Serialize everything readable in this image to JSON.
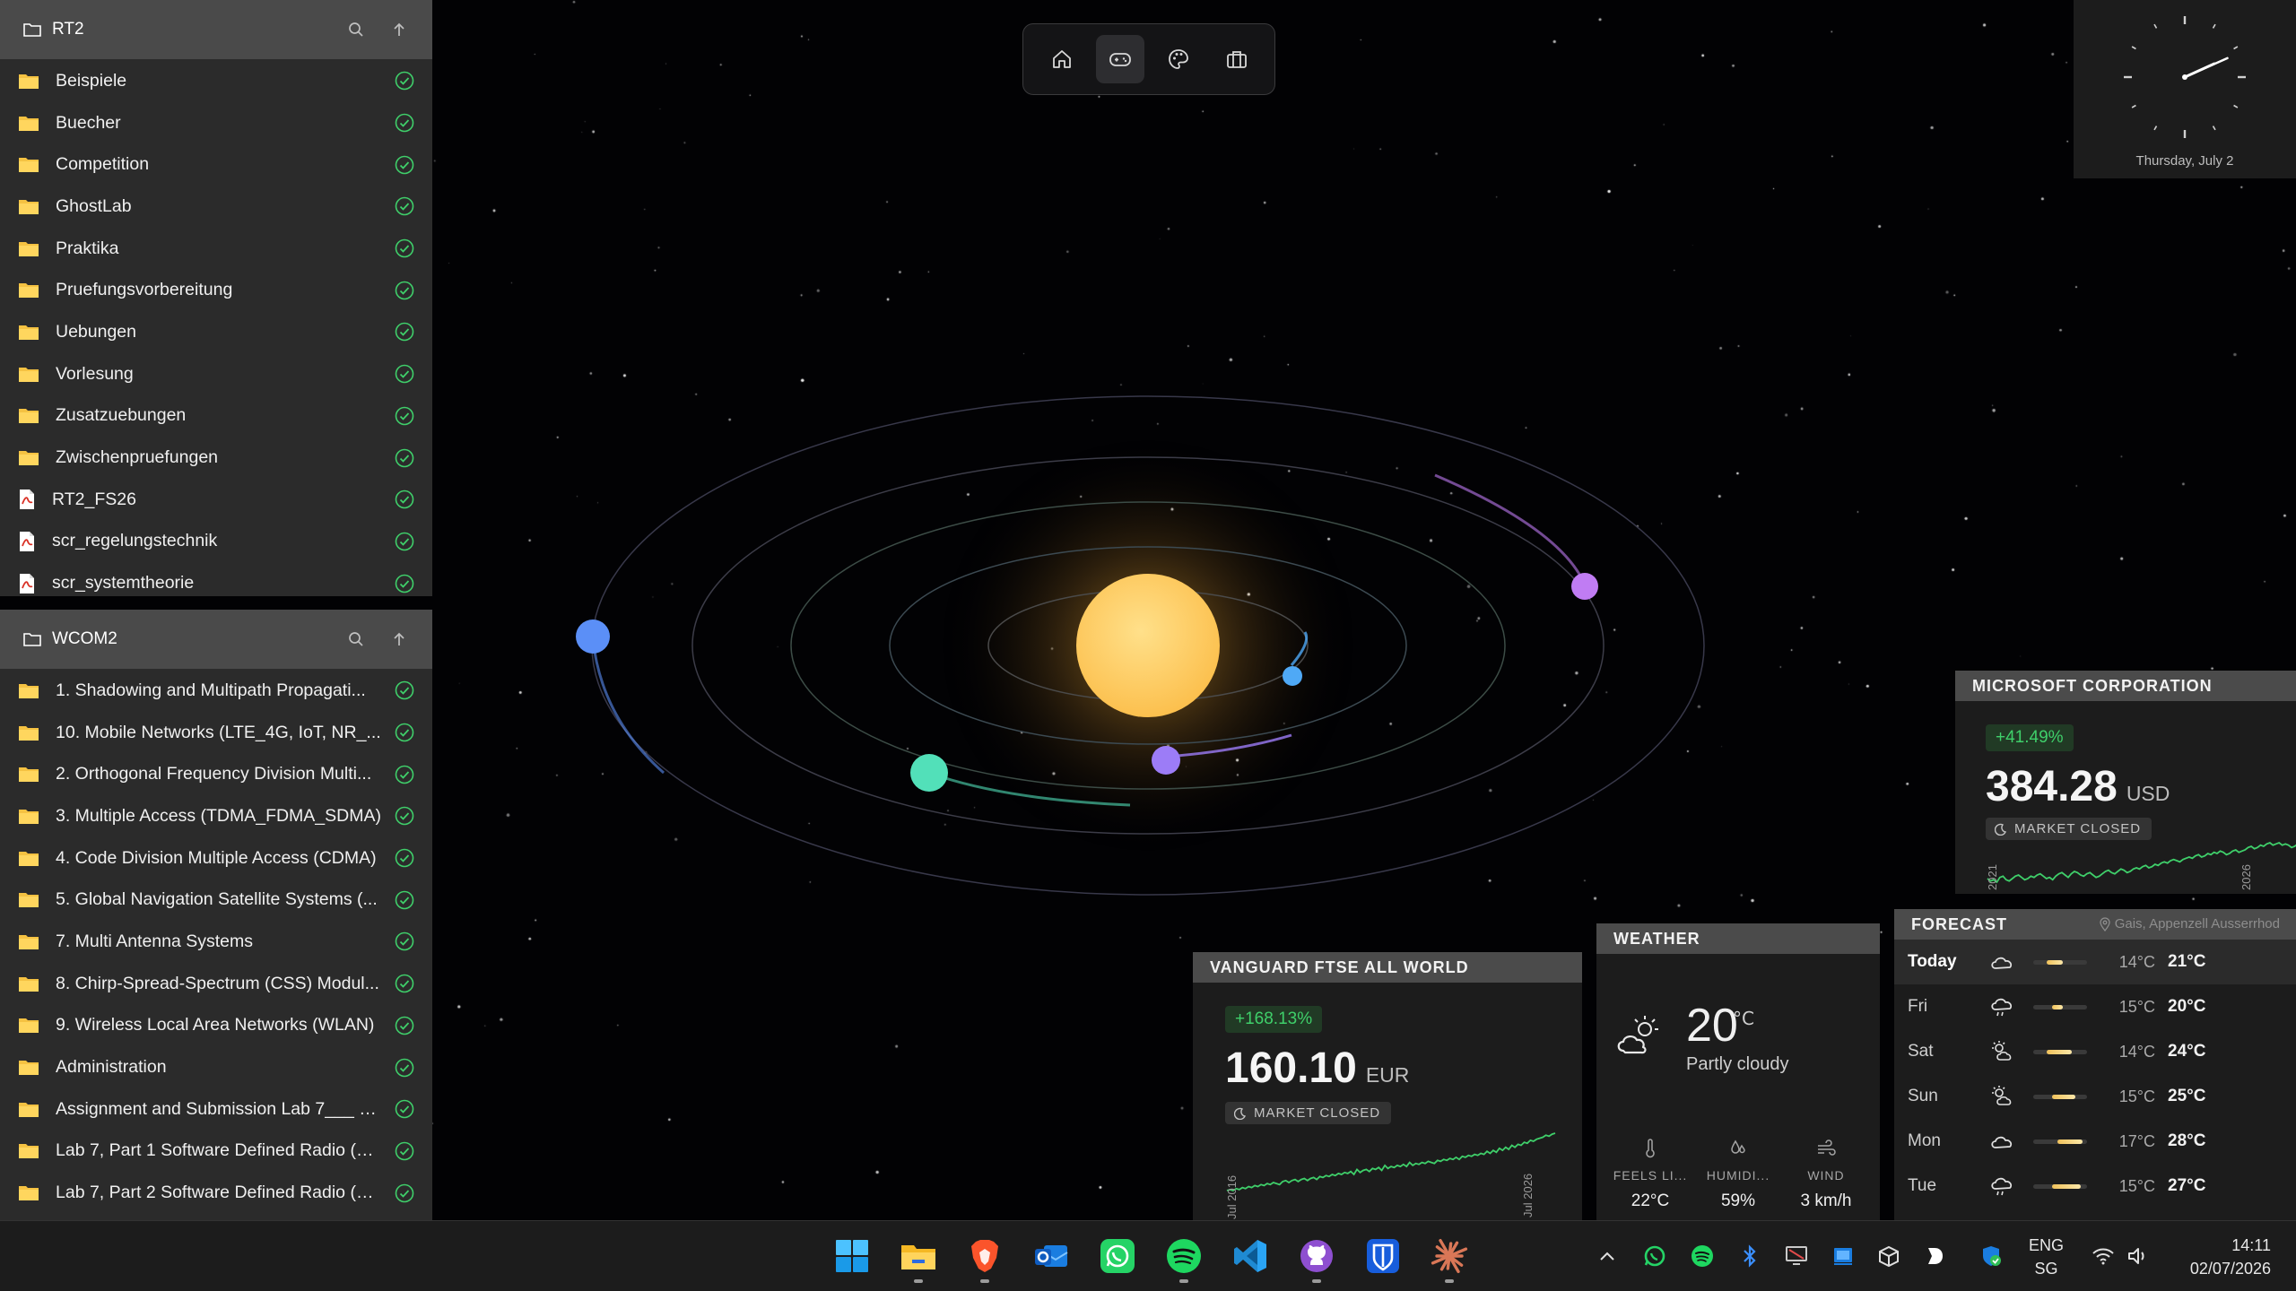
{
  "panels": [
    {
      "title": "RT2",
      "items": [
        {
          "label": "Beispiele",
          "type": "folder"
        },
        {
          "label": "Buecher",
          "type": "folder"
        },
        {
          "label": "Competition",
          "type": "folder"
        },
        {
          "label": "GhostLab",
          "type": "folder"
        },
        {
          "label": "Praktika",
          "type": "folder"
        },
        {
          "label": "Pruefungsvorbereitung",
          "type": "folder"
        },
        {
          "label": "Uebungen",
          "type": "folder"
        },
        {
          "label": "Vorlesung",
          "type": "folder"
        },
        {
          "label": "Zusatzuebungen",
          "type": "folder"
        },
        {
          "label": "Zwischenpruefungen",
          "type": "folder"
        },
        {
          "label": "RT2_FS26",
          "type": "pdf"
        },
        {
          "label": "scr_regelungstechnik",
          "type": "pdf"
        },
        {
          "label": "scr_systemtheorie",
          "type": "pdf"
        }
      ]
    },
    {
      "title": "WCOM2",
      "items": [
        {
          "label": "1. Shadowing and Multipath Propagati...",
          "type": "folder"
        },
        {
          "label": "10. Mobile Networks (LTE_4G, IoT, NR_...",
          "type": "folder"
        },
        {
          "label": "2. Orthogonal Frequency Division Multi...",
          "type": "folder"
        },
        {
          "label": "3. Multiple Access (TDMA_FDMA_SDMA)",
          "type": "folder"
        },
        {
          "label": "4. Code Division Multiple Access (CDMA)",
          "type": "folder"
        },
        {
          "label": "5. Global Navigation Satellite Systems (...",
          "type": "folder"
        },
        {
          "label": "7. Multi Antenna Systems",
          "type": "folder"
        },
        {
          "label": "8. Chirp-Spread-Spectrum (CSS) Modul...",
          "type": "folder"
        },
        {
          "label": "9. Wireless Local Area Networks (WLAN)",
          "type": "folder"
        },
        {
          "label": "Administration",
          "type": "folder"
        },
        {
          "label": "Assignment and Submission Lab 7___ S...",
          "type": "folder"
        },
        {
          "label": "Lab 7, Part 1 Software Defined Radio (S...",
          "type": "folder"
        },
        {
          "label": "Lab 7, Part 2 Software Defined Radio (S...",
          "type": "folder"
        }
      ]
    }
  ],
  "dock": {
    "buttons": [
      {
        "icon": "home-icon",
        "active": false
      },
      {
        "icon": "gamepad-icon",
        "active": true
      },
      {
        "icon": "palette-icon",
        "active": false
      },
      {
        "icon": "briefcase-icon",
        "active": false
      }
    ]
  },
  "clock": {
    "date": "Thursday, July 2",
    "time": "14:11"
  },
  "stocks": [
    {
      "title": "MICROSOFT CORPORATION",
      "change": "+41.49%",
      "price": "384.28",
      "currency": "USD",
      "status": "MARKET CLOSED",
      "axis_start": "2021",
      "axis_end": "2026",
      "sparkline": [
        32,
        34,
        33,
        35,
        31,
        30,
        33,
        34,
        32,
        30,
        29,
        31,
        33,
        32,
        30,
        31,
        29,
        28,
        30,
        32,
        31,
        33,
        30,
        28,
        27,
        29,
        31,
        28,
        26,
        27,
        29,
        30,
        28,
        27,
        29,
        31,
        30,
        28,
        26,
        25,
        27,
        28,
        26,
        24,
        25,
        27,
        26,
        24,
        23,
        24,
        22,
        21,
        23,
        22,
        20,
        21,
        19,
        18,
        19,
        17,
        16,
        17,
        18,
        16,
        15,
        14,
        15,
        13,
        12,
        14,
        13,
        11,
        12,
        10,
        11,
        9,
        10,
        12,
        11,
        9,
        8,
        10,
        9,
        8,
        6,
        5,
        7,
        6,
        4,
        5,
        3,
        2,
        4,
        3,
        2,
        4,
        3,
        4,
        6,
        5,
        3
      ]
    },
    {
      "title": "VANGUARD FTSE ALL WORLD",
      "change": "+168.13%",
      "price": "160.10",
      "currency": "EUR",
      "status": "MARKET CLOSED",
      "axis_start": "Jul 2016",
      "axis_end": "Jul 2026",
      "sparkline": [
        58,
        57,
        58,
        56,
        57,
        55,
        56,
        54,
        55,
        53,
        54,
        52,
        53,
        51,
        52,
        50,
        51,
        52,
        49,
        48,
        50,
        48,
        47,
        49,
        47,
        46,
        48,
        46,
        45,
        47,
        44,
        45,
        43,
        44,
        42,
        43,
        41,
        42,
        40,
        41,
        39,
        42,
        37,
        40,
        38,
        37,
        39,
        36,
        37,
        35,
        38,
        33,
        36,
        34,
        35,
        33,
        34,
        32,
        34,
        30,
        33,
        31,
        32,
        30,
        31,
        29,
        30,
        31,
        28,
        29,
        27,
        28,
        26,
        27,
        25,
        27,
        24,
        25,
        23,
        24,
        22,
        23,
        21,
        22,
        19,
        21,
        18,
        20,
        16,
        18,
        15,
        17,
        13,
        15,
        12,
        13,
        10,
        11,
        8,
        9,
        7,
        6,
        5,
        3,
        4,
        2,
        1
      ]
    }
  ],
  "weather": {
    "title": "WEATHER",
    "temp": "20",
    "unit": "°C",
    "description": "Partly cloudy",
    "metrics": [
      {
        "label": "FEELS LI...",
        "value": "22°C",
        "icon": "thermometer-icon"
      },
      {
        "label": "HUMIDI...",
        "value": "59%",
        "icon": "droplets-icon"
      },
      {
        "label": "WIND",
        "value": "3 km/h",
        "icon": "wind-icon"
      }
    ]
  },
  "forecast": {
    "title": "FORECAST",
    "location": "Gais, Appenzell Ausserrhod",
    "days": [
      {
        "day": "Today",
        "icon": "cloud-icon",
        "low": "14°C",
        "high": "21°C",
        "bar": [
          0.25,
          0.55
        ]
      },
      {
        "day": "Fri",
        "icon": "rain-icon",
        "low": "15°C",
        "high": "20°C",
        "bar": [
          0.35,
          0.55
        ]
      },
      {
        "day": "Sat",
        "icon": "sun-cloud-icon",
        "low": "14°C",
        "high": "24°C",
        "bar": [
          0.25,
          0.72
        ]
      },
      {
        "day": "Sun",
        "icon": "sun-cloud-icon",
        "low": "15°C",
        "high": "25°C",
        "bar": [
          0.35,
          0.78
        ]
      },
      {
        "day": "Mon",
        "icon": "cloud-icon",
        "low": "17°C",
        "high": "28°C",
        "bar": [
          0.45,
          0.92
        ]
      },
      {
        "day": "Tue",
        "icon": "rain-icon",
        "low": "15°C",
        "high": "27°C",
        "bar": [
          0.35,
          0.88
        ]
      }
    ]
  },
  "taskbar": {
    "apps": [
      {
        "name": "start-icon",
        "running": false
      },
      {
        "name": "file-explorer-icon",
        "running": true
      },
      {
        "name": "brave-browser-icon",
        "running": true
      },
      {
        "name": "outlook-icon",
        "running": false
      },
      {
        "name": "whatsapp-icon",
        "running": false
      },
      {
        "name": "spotify-icon",
        "running": true
      },
      {
        "name": "vscode-icon",
        "running": false
      },
      {
        "name": "github-desktop-icon",
        "running": true
      },
      {
        "name": "bitwarden-icon",
        "running": false
      },
      {
        "name": "claude-icon",
        "running": true
      }
    ],
    "tray": {
      "language": "ENG",
      "region": "SG",
      "time": "14:11",
      "date": "02/07/2026"
    }
  },
  "colors": {
    "accent_green": "#3fcf6a",
    "sun": "#fcd061",
    "planet_blue": "#5b8ff7",
    "planet_teal": "#52e0b9",
    "planet_violet": "#9c7cf7",
    "planet_purple": "#c07cf3",
    "planet_small_blue": "#4fa9f6"
  }
}
